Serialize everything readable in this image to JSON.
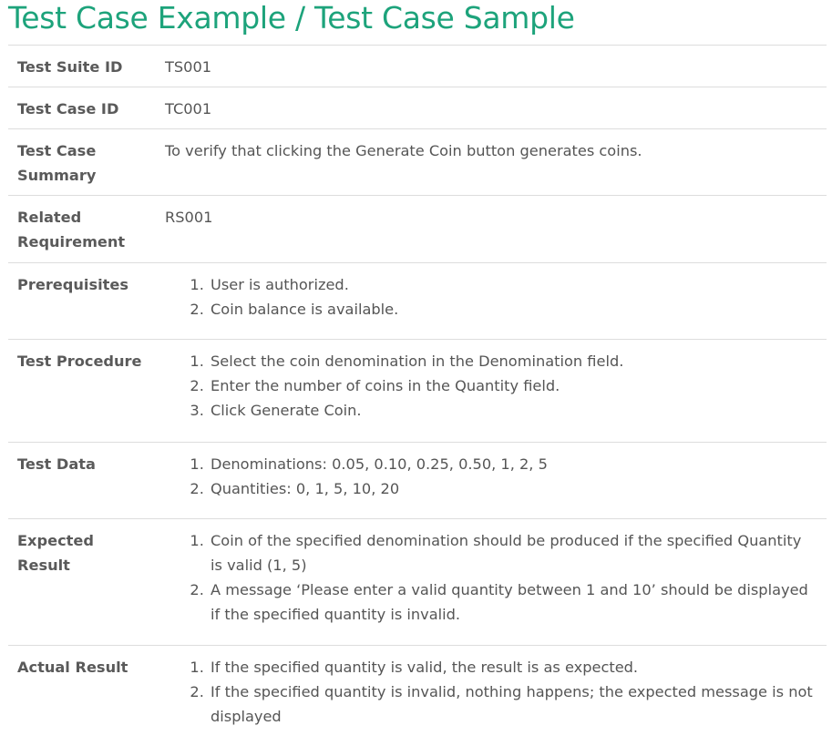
{
  "title": "Test Case Example / Test Case Sample",
  "rows": [
    {
      "label": "Test Suite ID",
      "value": "TS001"
    },
    {
      "label": "Test Case ID",
      "value": "TC001"
    },
    {
      "label": "Test Case Summary",
      "value": "To verify that clicking the Generate Coin button generates coins."
    },
    {
      "label": "Related Requirement",
      "value": "RS001"
    },
    {
      "label": "Prerequisites",
      "items": [
        "User is authorized.",
        "Coin balance is available."
      ]
    },
    {
      "label": "Test Procedure",
      "items": [
        "Select the coin denomination in the Denomination field.",
        "Enter the number of coins in the Quantity field.",
        "Click Generate Coin."
      ]
    },
    {
      "label": "Test Data",
      "items": [
        "Denominations: 0.05, 0.10, 0.25, 0.50, 1, 2, 5",
        "Quantities: 0, 1, 5, 10, 20"
      ]
    },
    {
      "label": "Expected Result",
      "items": [
        "Coin of the specified denomination should be produced if the specified Quantity is valid (1, 5)",
        "A message ‘Please enter a valid quantity between 1 and 10’ should be displayed if the specified quantity is invalid."
      ]
    },
    {
      "label": "Actual Result",
      "items": [
        "If the specified quantity is valid, the result is as expected.",
        "If the specified quantity is invalid, nothing happens; the expected message is not displayed"
      ]
    }
  ]
}
